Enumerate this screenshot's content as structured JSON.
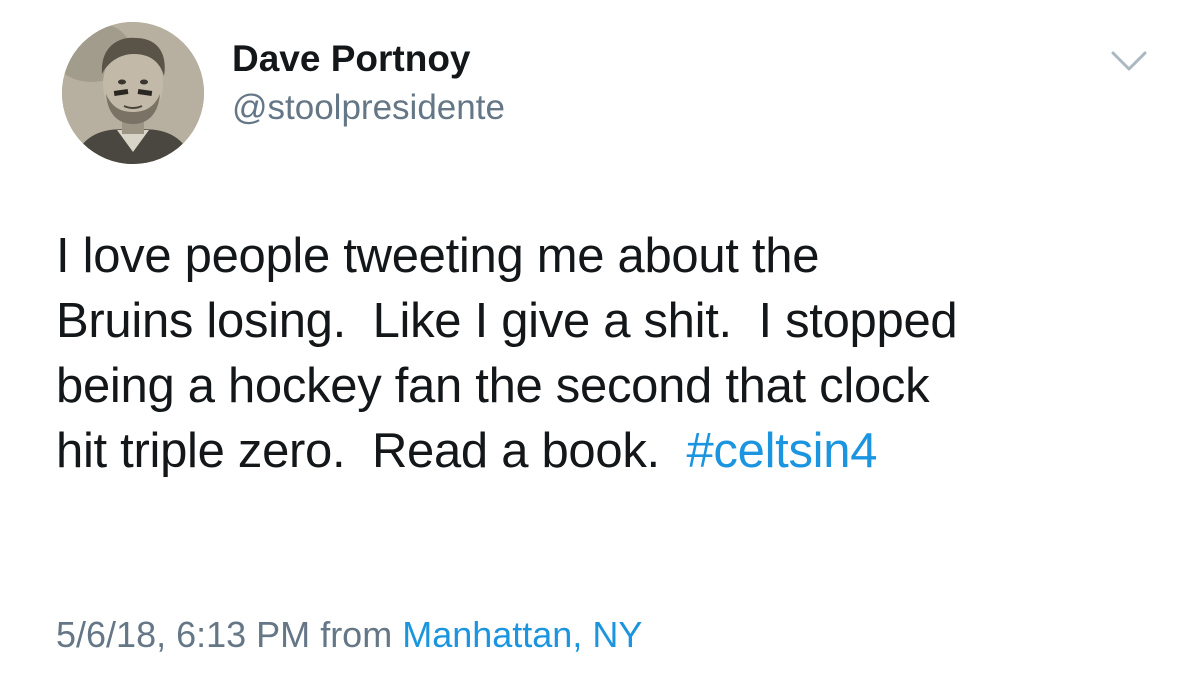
{
  "tweet": {
    "author": {
      "display_name": "Dave Portnoy",
      "handle": "@stoolpresidente"
    },
    "menu_icon": "chevron-down-icon",
    "text_lines": [
      "I love people tweeting me about the",
      "Bruins losing.  Like I give a shit.  I stopped",
      "being a hockey fan the second that clock",
      "hit triple zero.  Read a book.  "
    ],
    "hashtag": "#celtsin4",
    "timestamp": "5/6/18, 6:13 PM",
    "from_label": "from",
    "location": "Manhattan, NY"
  },
  "colors": {
    "text": "#14171a",
    "secondary": "#657786",
    "link": "#1b95e0",
    "chevron": "#aab8c2"
  }
}
